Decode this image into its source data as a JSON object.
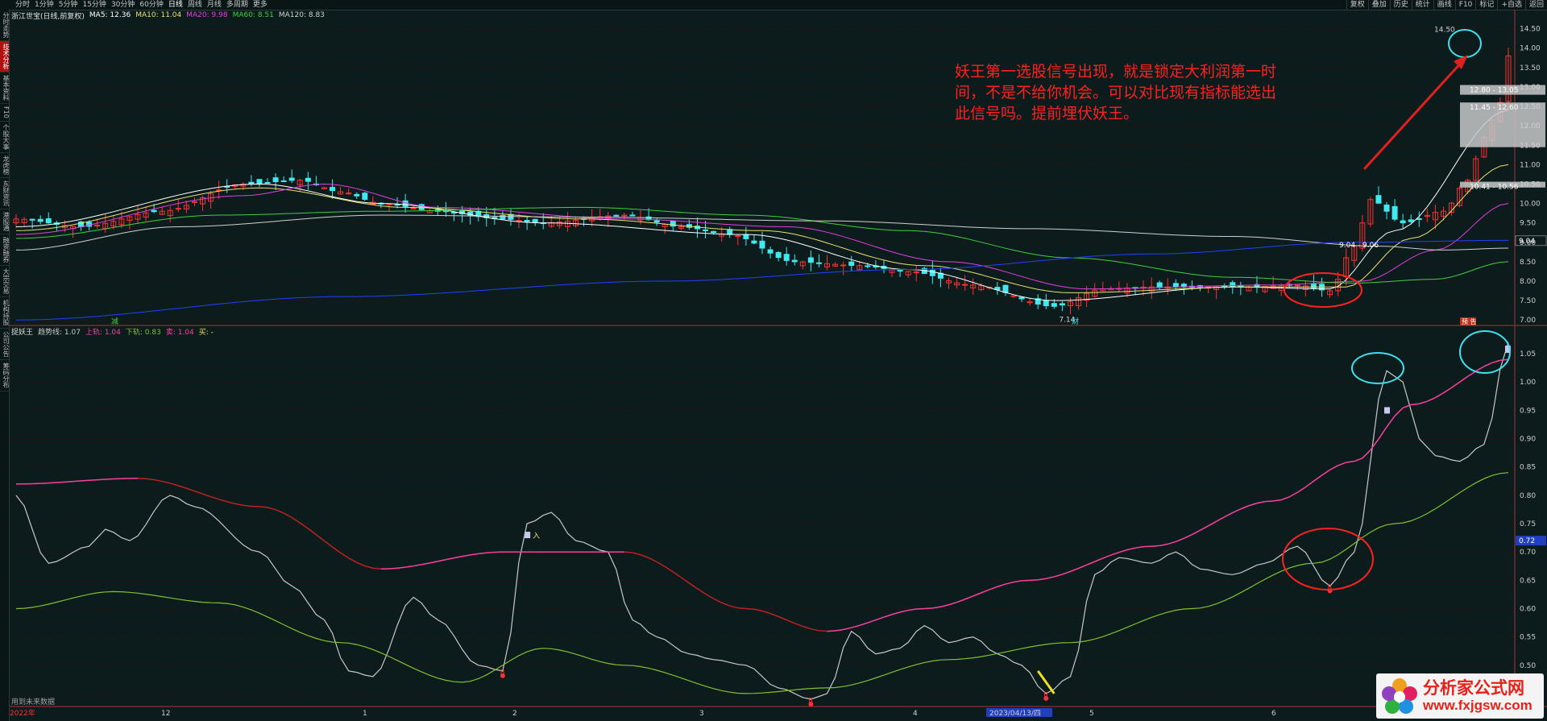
{
  "periods": [
    "分时",
    "1分钟",
    "5分钟",
    "15分钟",
    "30分钟",
    "60分钟",
    "日线",
    "周线",
    "月线",
    "多周期",
    "更多"
  ],
  "active_period": "日线",
  "right_menu": [
    "复权",
    "叠加",
    "历史",
    "统计",
    "画线",
    "F10",
    "标记",
    "+自选",
    "返回"
  ],
  "sidebar": [
    "分时走势",
    "技术分析",
    "基本资料",
    "F10",
    "个股大事",
    "龙虎榜",
    "东财资讯",
    "港股通",
    "融资融券",
    "大宗交易",
    "机构持股",
    "公司公告",
    "筹码分布"
  ],
  "sidebar_active": 1,
  "colors": {
    "bg": "#0c1c1c",
    "up": "#ff3030",
    "down": "#40e8f0",
    "grid": "#3a0e0e",
    "axis": "#b03030",
    "ma5": "#ffffff",
    "ma10": "#e8e070",
    "ma20": "#e040e0",
    "ma60": "#40d040",
    "ma120": "#d0d0d0",
    "ma250": "#2040ff",
    "upper": "#ff3fa0",
    "lower": "#80c030",
    "trend": "#c8c8c8"
  },
  "price_panel": {
    "name": "浙江世宝(日线,前复权)",
    "ma_labels": [
      {
        "text": "MA5: 12.36",
        "color": "#ffffff"
      },
      {
        "text": "MA10: 11.04",
        "color": "#e8e070"
      },
      {
        "text": "MA20: 9.98",
        "color": "#e040e0"
      },
      {
        "text": "MA60: 8.51",
        "color": "#40d040"
      },
      {
        "text": "MA120: 8.83",
        "color": "#d0d0d0"
      }
    ],
    "ma250_value": "",
    "low_label": "7.14",
    "high_label": "14.50",
    "box_labels": [
      "12.80 - 13.05",
      "11.45 - 12.60",
      "10.41 - 10.56",
      "9.04 - 9.06"
    ],
    "date_marker_left": "减",
    "date_marker_mid": "财",
    "date_marker_right": "预 告",
    "price_tag": "9.04"
  },
  "indicator_panel": {
    "name": "捉妖王",
    "legend": [
      {
        "label": "趋势线",
        "value": "1.07",
        "color": "#c8c8c8"
      },
      {
        "label": "上轨",
        "value": "1.04",
        "color": "#ff3fa0"
      },
      {
        "label": "下轨",
        "value": "0.83",
        "color": "#80c030"
      },
      {
        "label": "卖",
        "value": "1.04",
        "color": "#ff3fa0"
      },
      {
        "label": "买",
        "value": "-",
        "color": "#e8e070"
      }
    ],
    "sell_mark": "入",
    "buy_marks": [
      "B",
      "B",
      "B",
      "B",
      "B"
    ],
    "value_tag": "0.72"
  },
  "x_axis": {
    "labels": [
      "2022年",
      "12",
      "1",
      "2",
      "3",
      "4",
      "2023/04/13/四",
      "5",
      "6"
    ],
    "footer": "用到未来数据"
  },
  "annotation": "妖王第一选股信号出现，就是锁定大利润第一时间，不是不给你机会。可以对比现有指标能选出此信号吗。提前埋伏妖王。",
  "watermark": {
    "title": "分析家公式网",
    "url": "www.fxjgsw.com"
  },
  "chart_data": [
    {
      "type": "candlestick",
      "title": "浙江世宝(日线,前复权)",
      "ylim": [
        6.9,
        14.7
      ],
      "yticks": [
        7.0,
        7.5,
        8.0,
        8.5,
        9.0,
        9.5,
        10.0,
        10.5,
        11.0,
        11.5,
        12.0,
        12.5,
        13.0,
        13.5,
        14.0,
        14.5
      ],
      "anchors": [
        [
          0,
          9.6
        ],
        [
          8,
          9.4
        ],
        [
          18,
          9.8
        ],
        [
          28,
          10.5
        ],
        [
          35,
          10.6
        ],
        [
          40,
          10.3
        ],
        [
          45,
          10.0
        ],
        [
          52,
          9.8
        ],
        [
          60,
          9.6
        ],
        [
          65,
          9.5
        ],
        [
          75,
          9.7
        ],
        [
          82,
          9.4
        ],
        [
          88,
          9.2
        ],
        [
          96,
          8.5
        ],
        [
          104,
          8.4
        ],
        [
          110,
          8.25
        ],
        [
          118,
          7.9
        ],
        [
          128,
          7.35
        ],
        [
          134,
          7.8
        ],
        [
          140,
          7.85
        ],
        [
          152,
          7.85
        ],
        [
          158,
          7.9
        ],
        [
          162,
          7.75
        ],
        [
          165,
          8.9
        ],
        [
          167,
          10.1
        ],
        [
          171,
          9.5
        ],
        [
          176,
          9.8
        ],
        [
          179,
          10.6
        ],
        [
          181,
          11.7
        ],
        [
          183,
          12.6
        ],
        [
          184,
          13.8
        ]
      ],
      "count": 185,
      "ma_series": [
        {
          "name": "MA5",
          "anchors": [
            [
              0,
              9.4
            ],
            [
              30,
              10.5
            ],
            [
              45,
              10.0
            ],
            [
              65,
              9.5
            ],
            [
              90,
              9.2
            ],
            [
              110,
              8.3
            ],
            [
              128,
              7.5
            ],
            [
              150,
              7.85
            ],
            [
              162,
              7.8
            ],
            [
              170,
              9.3
            ],
            [
              184,
              12.4
            ]
          ]
        },
        {
          "name": "MA10",
          "anchors": [
            [
              0,
              9.3
            ],
            [
              30,
              10.4
            ],
            [
              48,
              9.9
            ],
            [
              70,
              9.6
            ],
            [
              92,
              9.3
            ],
            [
              112,
              8.4
            ],
            [
              130,
              7.7
            ],
            [
              152,
              7.85
            ],
            [
              164,
              7.85
            ],
            [
              172,
              9.1
            ],
            [
              184,
              11.0
            ]
          ]
        },
        {
          "name": "MA20",
          "anchors": [
            [
              0,
              9.2
            ],
            [
              28,
              10.2
            ],
            [
              38,
              10.5
            ],
            [
              52,
              9.9
            ],
            [
              75,
              9.6
            ],
            [
              95,
              9.4
            ],
            [
              115,
              8.5
            ],
            [
              132,
              7.8
            ],
            [
              155,
              7.9
            ],
            [
              166,
              8.0
            ],
            [
              175,
              8.8
            ],
            [
              184,
              10.0
            ]
          ]
        },
        {
          "name": "MA60",
          "anchors": [
            [
              0,
              9.1
            ],
            [
              25,
              9.7
            ],
            [
              45,
              9.8
            ],
            [
              70,
              9.9
            ],
            [
              90,
              9.7
            ],
            [
              110,
              9.3
            ],
            [
              130,
              8.6
            ],
            [
              150,
              8.1
            ],
            [
              165,
              7.95
            ],
            [
              175,
              8.05
            ],
            [
              184,
              8.5
            ]
          ]
        },
        {
          "name": "MA120",
          "anchors": [
            [
              0,
              8.8
            ],
            [
              20,
              9.4
            ],
            [
              45,
              9.7
            ],
            [
              70,
              9.65
            ],
            [
              100,
              9.55
            ],
            [
              125,
              9.35
            ],
            [
              150,
              9.15
            ],
            [
              168,
              8.9
            ],
            [
              176,
              8.8
            ],
            [
              184,
              8.85
            ]
          ]
        },
        {
          "name": "MA250",
          "anchors": [
            [
              0,
              7.0
            ],
            [
              40,
              7.6
            ],
            [
              80,
              8.0
            ],
            [
              110,
              8.3
            ],
            [
              140,
              8.7
            ],
            [
              165,
              9.0
            ],
            [
              184,
              9.05
            ]
          ]
        }
      ]
    },
    {
      "type": "line",
      "title": "捉妖王",
      "ylim": [
        0.43,
        1.08
      ],
      "yticks": [
        0.45,
        0.5,
        0.55,
        0.6,
        0.65,
        0.7,
        0.75,
        0.8,
        0.85,
        0.9,
        0.95,
        1.0,
        1.05
      ],
      "series": [
        {
          "name": "趋势线",
          "anchors": [
            [
              0,
              0.8
            ],
            [
              4,
              0.68
            ],
            [
              9,
              0.71
            ],
            [
              11,
              0.74
            ],
            [
              14,
              0.72
            ],
            [
              19,
              0.8
            ],
            [
              22,
              0.78
            ],
            [
              30,
              0.7
            ],
            [
              34,
              0.64
            ],
            [
              38,
              0.58
            ],
            [
              41,
              0.49
            ],
            [
              44,
              0.48
            ],
            [
              49,
              0.62
            ],
            [
              52,
              0.58
            ],
            [
              57,
              0.5
            ],
            [
              60,
              0.49
            ],
            [
              63,
              0.75
            ],
            [
              66,
              0.77
            ],
            [
              69,
              0.72
            ],
            [
              73,
              0.7
            ],
            [
              76,
              0.58
            ],
            [
              79,
              0.55
            ],
            [
              83,
              0.52
            ],
            [
              86,
              0.51
            ],
            [
              90,
              0.5
            ],
            [
              94,
              0.46
            ],
            [
              98,
              0.44
            ],
            [
              100,
              0.45
            ],
            [
              103,
              0.56
            ],
            [
              106,
              0.52
            ],
            [
              109,
              0.53
            ],
            [
              112,
              0.57
            ],
            [
              115,
              0.54
            ],
            [
              118,
              0.55
            ],
            [
              121,
              0.52
            ],
            [
              124,
              0.5
            ],
            [
              127,
              0.45
            ],
            [
              130,
              0.48
            ],
            [
              133,
              0.66
            ],
            [
              136,
              0.69
            ],
            [
              140,
              0.68
            ],
            [
              143,
              0.7
            ],
            [
              146,
              0.67
            ],
            [
              150,
              0.66
            ],
            [
              154,
              0.68
            ],
            [
              158,
              0.71
            ],
            [
              162,
              0.64
            ],
            [
              165,
              0.7
            ],
            [
              169,
              1.02
            ],
            [
              171,
              1.0
            ],
            [
              173,
              0.9
            ],
            [
              175,
              0.87
            ],
            [
              178,
              0.86
            ],
            [
              181,
              0.89
            ],
            [
              184,
              1.07
            ]
          ]
        },
        {
          "name": "上轨",
          "anchors": [
            [
              0,
              0.82
            ],
            [
              15,
              0.83
            ],
            [
              30,
              0.78
            ],
            [
              45,
              0.67
            ],
            [
              60,
              0.7
            ],
            [
              75,
              0.7
            ],
            [
              90,
              0.6
            ],
            [
              100,
              0.56
            ],
            [
              112,
              0.6
            ],
            [
              125,
              0.65
            ],
            [
              140,
              0.71
            ],
            [
              155,
              0.79
            ],
            [
              165,
              0.86
            ],
            [
              172,
              0.96
            ],
            [
              184,
              1.04
            ]
          ]
        },
        {
          "name": "下轨",
          "anchors": [
            [
              0,
              0.6
            ],
            [
              12,
              0.63
            ],
            [
              25,
              0.61
            ],
            [
              40,
              0.54
            ],
            [
              55,
              0.47
            ],
            [
              65,
              0.53
            ],
            [
              75,
              0.5
            ],
            [
              90,
              0.45
            ],
            [
              100,
              0.46
            ],
            [
              115,
              0.51
            ],
            [
              130,
              0.54
            ],
            [
              145,
              0.6
            ],
            [
              160,
              0.68
            ],
            [
              170,
              0.75
            ],
            [
              184,
              0.84
            ]
          ]
        }
      ]
    }
  ]
}
